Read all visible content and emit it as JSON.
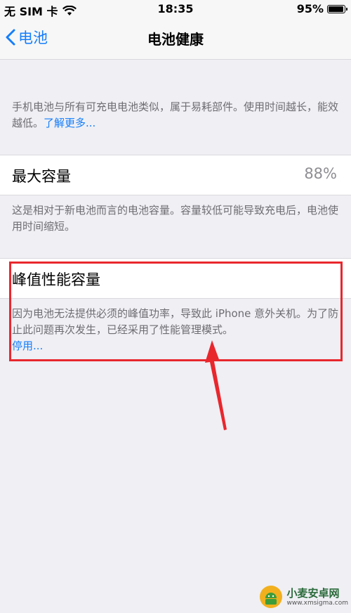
{
  "status_bar": {
    "carrier": "无 SIM 卡",
    "time": "18:35",
    "battery_percent_text": "95%",
    "battery_level": 0.95
  },
  "nav": {
    "back_label": "电池",
    "title": "电池健康"
  },
  "sections": {
    "intro": {
      "text": "手机电池与所有可充电电池类似，属于易耗部件。使用时间越长，能效越低。",
      "link": "了解更多..."
    },
    "max_capacity": {
      "label": "最大容量",
      "value": "88%",
      "description": "这是相对于新电池而言的电池容量。容量较低可能导致充电后，电池使用时间缩短。"
    },
    "peak_performance": {
      "label": "峰值性能容量",
      "description": "因为电池无法提供必须的峰值功率，导致此 iPhone 意外关机。为了防止此问题再次发生，已经采用了性能管理模式。",
      "link": "停用..."
    }
  },
  "watermark": {
    "name": "小麦安卓网",
    "url": "www.xmsigma.com"
  },
  "colors": {
    "accent": "#157efb",
    "highlight": "#e8272d",
    "background": "#efeff4"
  }
}
